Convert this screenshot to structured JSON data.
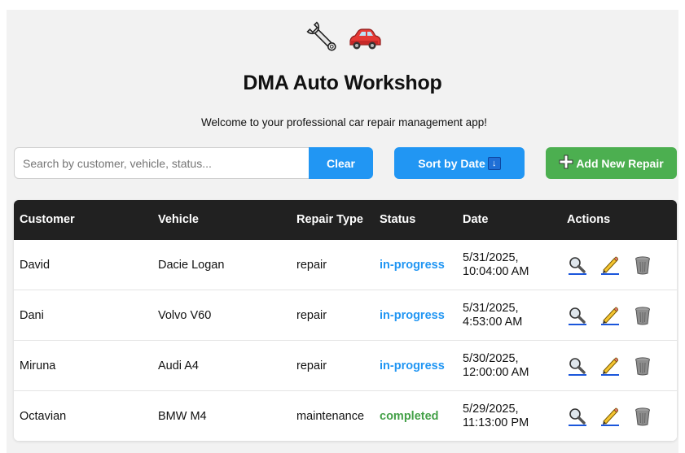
{
  "header": {
    "title": "DMA Auto Workshop",
    "subtitle": "Welcome to your professional car repair management app!",
    "icons": [
      "wrench-icon",
      "car-icon"
    ]
  },
  "toolbar": {
    "search_placeholder": "Search by customer, vehicle, status...",
    "search_value": "",
    "clear_label": "Clear",
    "sort_label": "Sort by Date",
    "sort_icon_glyph": "↓",
    "add_label": "Add New Repair"
  },
  "table": {
    "columns": [
      "Customer",
      "Vehicle",
      "Repair Type",
      "Status",
      "Date",
      "Actions"
    ],
    "rows": [
      {
        "customer": "David",
        "vehicle": "Dacie Logan",
        "repair_type": "repair",
        "status": "in-progress",
        "date_line1": "5/31/2025,",
        "date_line2": "10:04:00 AM"
      },
      {
        "customer": "Dani",
        "vehicle": "Volvo V60",
        "repair_type": "repair",
        "status": "in-progress",
        "date_line1": "5/31/2025,",
        "date_line2": "4:53:00 AM"
      },
      {
        "customer": "Miruna",
        "vehicle": "Audi A4",
        "repair_type": "repair",
        "status": "in-progress",
        "date_line1": "5/30/2025,",
        "date_line2": "12:00:00 AM"
      },
      {
        "customer": "Octavian",
        "vehicle": "BMW M4",
        "repair_type": "maintenance",
        "status": "completed",
        "date_line1": "5/29/2025,",
        "date_line2": "11:13:00 PM"
      }
    ],
    "row_action_icons": [
      "view-icon",
      "edit-icon",
      "delete-icon"
    ]
  },
  "colors": {
    "primary": "#2196f3",
    "success": "#4caf50",
    "header_bg": "#212121",
    "status_in_progress": "#2196f3",
    "status_completed": "#43a047"
  }
}
